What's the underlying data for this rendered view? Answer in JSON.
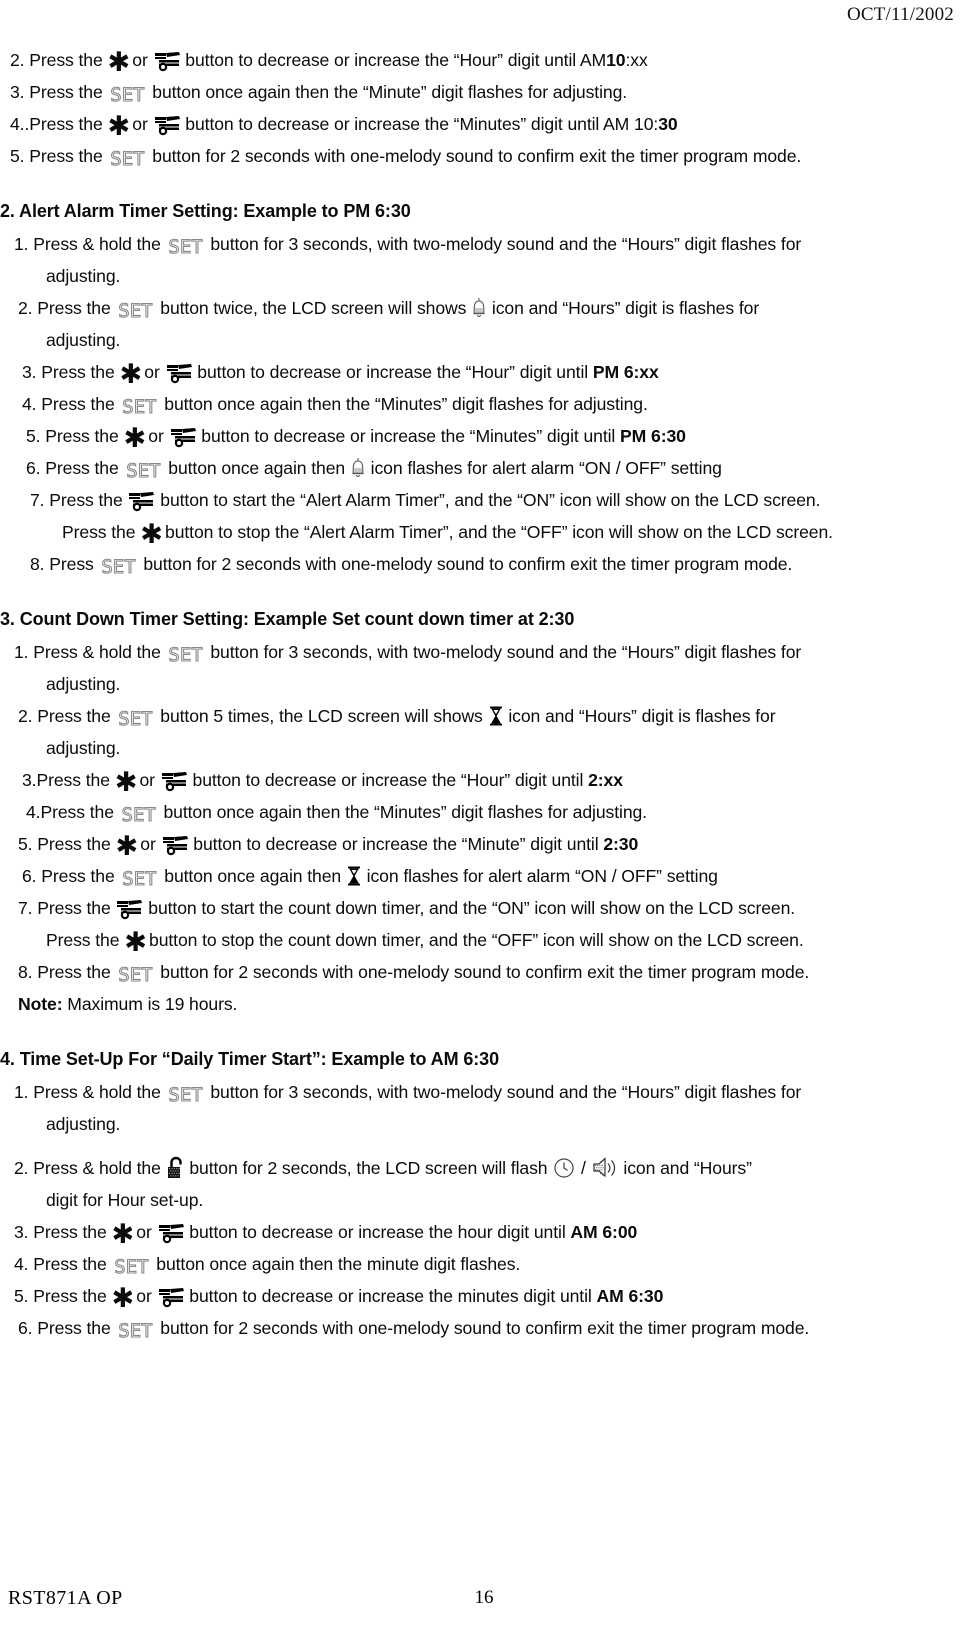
{
  "header": {
    "date": "OCT/11/2002"
  },
  "footer": {
    "doc_code": "RST871A OP",
    "page_number": "16"
  },
  "icons": {
    "star": "asterisk-decrease-button-icon",
    "mower": "sprinkler-increase-button-icon",
    "set": "SET",
    "bell": "alert-alarm-bell-icon",
    "hourglass": "count-down-hourglass-icon",
    "clock": "clock-icon",
    "speaker": "sound-speaker-icon",
    "lock": "open-padlock-button-icon"
  },
  "continued_steps": {
    "step2": {
      "a": "2. Press the ",
      "b": " or ",
      "c": " button to decrease or increase the “Hour” digit until AM",
      "bold": "10",
      "d": ":xx"
    },
    "step3": {
      "a": "3. Press the ",
      "b": " button once again then the “Minute” digit flashes for adjusting."
    },
    "step4": {
      "a": "4..Press the ",
      "b": " or ",
      "c": " button to decrease or increase the “Minutes” digit until AM 10:",
      "bold": "30"
    },
    "step5": {
      "a": "5. Press the ",
      "b": " button for 2 seconds with one-melody sound to confirm exit the timer program mode."
    }
  },
  "section2": {
    "heading": "2. Alert Alarm Timer Setting: Example to PM 6:30",
    "steps": {
      "s1": {
        "a": "1. Press & hold the ",
        "b": " button for 3 seconds, with two-melody sound and the “Hours” digit flashes for",
        "cont": "adjusting."
      },
      "s2": {
        "a": "2. Press the ",
        "b": " button twice, the LCD screen will shows ",
        "c": " icon and “Hours” digit is flashes for",
        "cont": "adjusting."
      },
      "s3": {
        "a": "3. Press the ",
        "b": " or ",
        "c": " button to decrease or increase the “Hour” digit until ",
        "bold": "PM 6:xx"
      },
      "s4": {
        "a": "4. Press the ",
        "b": " button once again then the “Minutes” digit flashes for adjusting."
      },
      "s5": {
        "a": "5. Press the ",
        "b": " or ",
        "c": " button to decrease or increase the “Minutes” digit until ",
        "bold": "PM 6:30"
      },
      "s6": {
        "a": "6. Press the ",
        "b": " button once again then ",
        "c": " icon flashes for alert alarm “ON / OFF” setting"
      },
      "s7": {
        "a": "7. Press the ",
        "b": " button to start the “Alert Alarm Timer”, and the “ON” icon will show on the LCD screen.",
        "c": "Press the ",
        "d": " button to stop the “Alert Alarm Timer”, and the “OFF” icon will show on the LCD screen."
      },
      "s8": {
        "a": "8. Press ",
        "b": " button for 2 seconds with one-melody sound to confirm exit the timer program mode."
      }
    }
  },
  "section3": {
    "heading": "3. Count Down Timer Setting: Example Set count down timer at 2:30",
    "steps": {
      "s1": {
        "a": "1. Press & hold the ",
        "b": " button for 3 seconds, with two-melody sound and the “Hours” digit flashes for",
        "cont": "adjusting."
      },
      "s2": {
        "a": "2. Press the ",
        "b": " button 5 times, the LCD screen will shows ",
        "c": " icon and “Hours” digit is flashes for",
        "cont": "adjusting."
      },
      "s3": {
        "a": "3.Press the ",
        "b": " or ",
        "c": " button to decrease or increase the “Hour” digit until  ",
        "bold": "2:xx"
      },
      "s4": {
        "a": "4.Press the ",
        "b": " button once again then the “Minutes” digit flashes for adjusting."
      },
      "s5": {
        "a": "5. Press the ",
        "b": " or ",
        "c": " button to decrease or increase the “Minute” digit until ",
        "bold": "2:30"
      },
      "s6": {
        "a": "6. Press the ",
        "b": " button once again then ",
        "c": " icon flashes for alert alarm  “ON / OFF” setting"
      },
      "s7": {
        "a": "7. Press the ",
        "b": " button to start the count down timer, and the “ON” icon will show on the LCD screen.",
        "c": "Press the ",
        "d": " button to stop the count down timer, and the “OFF” icon will show on the LCD screen."
      },
      "s8": {
        "a": "8. Press the ",
        "b": " button for 2 seconds with one-melody sound to confirm exit the timer program mode."
      },
      "note_label": "Note:",
      "note_text": " Maximum is 19 hours."
    }
  },
  "section4": {
    "heading": "4. Time Set-Up For “Daily Timer Start”: Example to AM 6:30",
    "steps": {
      "s1": {
        "a": "1. Press & hold the ",
        "b": " button for 3 seconds, with two-melody sound and the “Hours” digit flashes for",
        "cont": "adjusting."
      },
      "s2": {
        "a": "2. Press & hold the ",
        "b": " button for 2 seconds, the LCD screen will flash ",
        "c": " / ",
        "d": "  icon and “Hours”",
        "cont": "digit for Hour set-up."
      },
      "s3": {
        "a": "3. Press the ",
        "b": " or ",
        "c": " button to decrease or increase the hour digit until ",
        "bold": "AM 6:00"
      },
      "s4": {
        "a": "4. Press the ",
        "b": " button once again then the minute digit flashes."
      },
      "s5": {
        "a": "5. Press the ",
        "b": " or ",
        "c": " button to decrease or increase the minutes digit until ",
        "bold": "AM 6:30"
      },
      "s6": {
        "a": "6. Press the ",
        "b": " button for 2 seconds with one-melody sound to confirm exit the timer program mode."
      }
    }
  }
}
